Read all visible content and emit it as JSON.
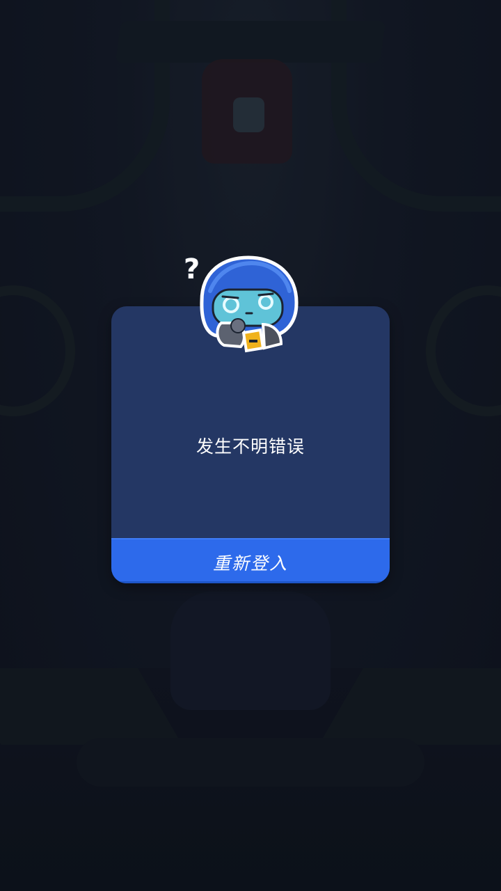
{
  "dialog": {
    "message": "发生不明错误",
    "button_label": "重新登入"
  },
  "mascot": {
    "question_mark": "?"
  },
  "colors": {
    "background": "#121826",
    "dialog_bg": "#243764",
    "button_bg": "#2d6aeb",
    "mascot_helmet": "#2f63d6",
    "mascot_face": "#5fc3d8",
    "mascot_badge": "#f0b21c"
  }
}
